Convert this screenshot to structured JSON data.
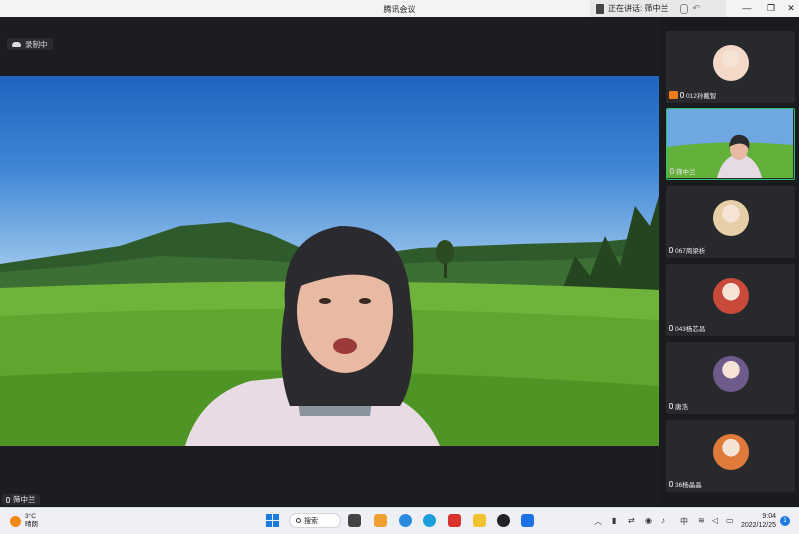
{
  "window": {
    "title": "腾讯会议",
    "speaking_label": "正在讲话: 筛中兰",
    "minimize": "—",
    "restore": "❐",
    "close": "✕"
  },
  "recording": {
    "label": "录制中"
  },
  "main_video": {
    "name": "筛中兰"
  },
  "participants": [
    {
      "name": "012孙戴智",
      "host": true,
      "active": false,
      "avatar_color": "#f4d9c8"
    },
    {
      "name": "筛中兰",
      "host": false,
      "active": true,
      "avatar_color": "#7fb34a"
    },
    {
      "name": "067周梁析",
      "host": false,
      "active": false,
      "avatar_color": "#e6cfa8"
    },
    {
      "name": "043杨芯昌",
      "host": false,
      "active": false,
      "avatar_color": "#c94a3a"
    },
    {
      "name": "唐浩",
      "host": false,
      "active": false,
      "avatar_color": "#6f5a8c"
    },
    {
      "name": "36杨晶晶",
      "host": false,
      "active": false,
      "avatar_color": "#e07a3a"
    }
  ],
  "taskbar": {
    "weather_temp": "3°C",
    "weather_desc": "晴朗",
    "search_label": "搜索",
    "ime_label": "中",
    "time": "9:04",
    "date": "2022/12/25",
    "notifications": "1"
  },
  "colors": {
    "active_border": "#2bbf6f",
    "host_tag": "#ef7a1a",
    "accent": "#1f7ae0"
  }
}
